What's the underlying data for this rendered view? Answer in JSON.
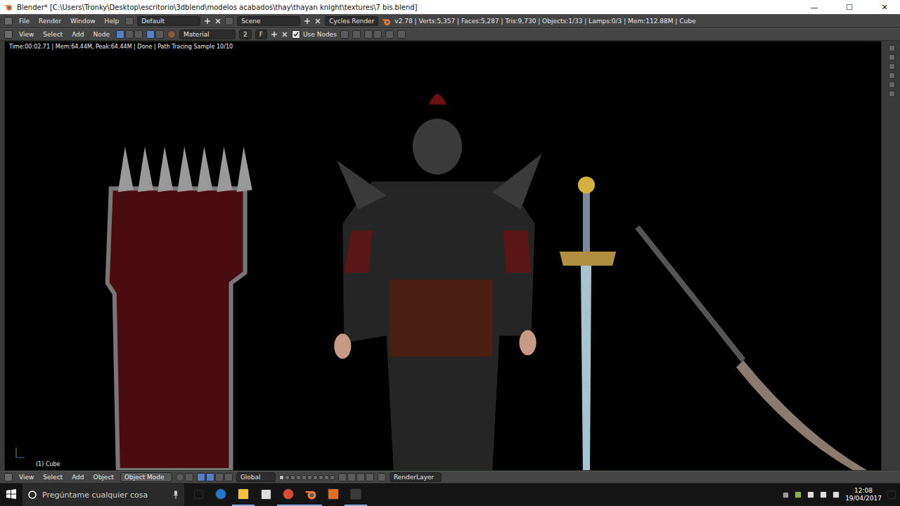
{
  "window": {
    "title": "Blender* [C:\\Users\\Tronky\\Desktop\\escritorio\\3dblend\\modelos acabados\\thay\\thayan knight\\textures\\7 bis.blend]",
    "controls": [
      "—",
      "☐",
      "✕"
    ]
  },
  "info_header": {
    "menus": [
      "File",
      "Render",
      "Window",
      "Help"
    ],
    "layout": "Default",
    "scene": "Scene",
    "engine": "Cycles Render",
    "stats": "v2.78 | Verts:5,357 | Faces:5,287 | Tris:9,730 | Objects:1/33 | Lamps:0/3 | Mem:112.88M | Cube"
  },
  "node_header": {
    "menus": [
      "View",
      "Select",
      "Add",
      "Node"
    ],
    "material": "Material",
    "users": "2",
    "fake_user": "F",
    "use_nodes": {
      "label": "Use Nodes",
      "checked": true
    }
  },
  "viewport": {
    "render_info": "Time:00:02.71 | Mem:64.44M, Peak:64.44M | Done | Path Tracing Sample 10/10",
    "object_label": "(1) Cube"
  },
  "view3d_header": {
    "menus": [
      "View",
      "Select",
      "Add",
      "Object"
    ],
    "mode": "Object Mode",
    "orientation": "Global",
    "render_layer": "RenderLayer"
  },
  "taskbar": {
    "search_placeholder": "Pregúntame cualquier cosa",
    "time": "12:08",
    "date": "19/04/2017"
  }
}
